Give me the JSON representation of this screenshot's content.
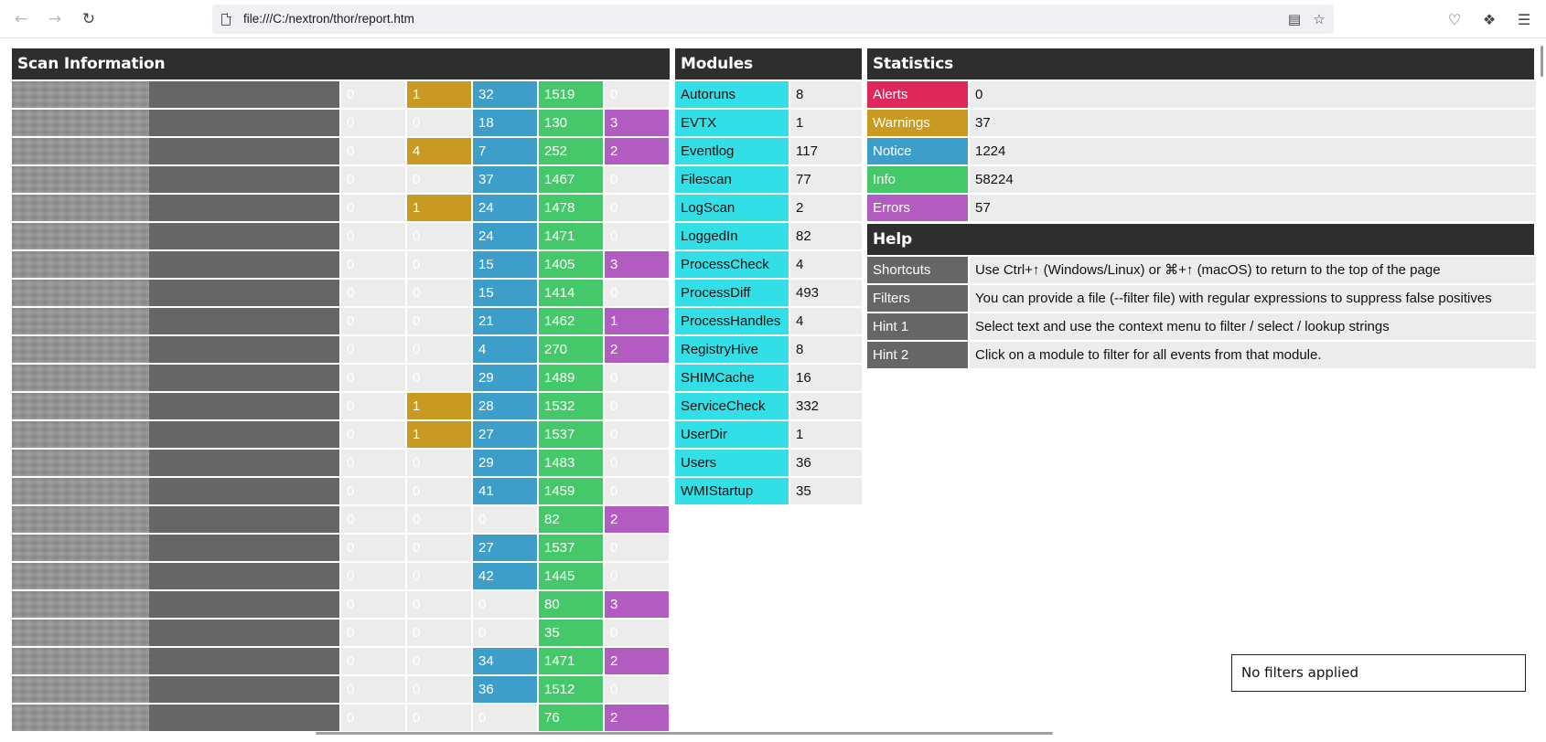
{
  "browser": {
    "url": "file:///C:/nextron/thor/report.htm",
    "icons": {
      "back": "arrow-left-icon",
      "forward": "arrow-right-icon",
      "reload": "reload-icon",
      "page": "page-icon",
      "reader": "reader-view-icon",
      "bookmark": "star-icon",
      "pocket": "pocket-icon",
      "extensions": "extensions-icon",
      "menu": "hamburger-menu-icon"
    }
  },
  "colors": {
    "header": "#2e2e2e",
    "alert": "#e0275a",
    "warning": "#c89a22",
    "notice": "#3d9fc9",
    "info": "#44c86a",
    "error": "#b25bc0",
    "module": "#33dfe6",
    "host": "#666666"
  },
  "scan": {
    "title": "Scan Information",
    "rows": [
      {
        "alerts": "0",
        "warnings": "1",
        "notices": "32",
        "infos": "1519",
        "errors": "0"
      },
      {
        "alerts": "0",
        "warnings": "0",
        "notices": "18",
        "infos": "130",
        "errors": "3"
      },
      {
        "alerts": "0",
        "warnings": "4",
        "notices": "7",
        "infos": "252",
        "errors": "2"
      },
      {
        "alerts": "0",
        "warnings": "0",
        "notices": "37",
        "infos": "1467",
        "errors": "0"
      },
      {
        "alerts": "0",
        "warnings": "1",
        "notices": "24",
        "infos": "1478",
        "errors": "0"
      },
      {
        "alerts": "0",
        "warnings": "0",
        "notices": "24",
        "infos": "1471",
        "errors": "0"
      },
      {
        "alerts": "0",
        "warnings": "0",
        "notices": "15",
        "infos": "1405",
        "errors": "3"
      },
      {
        "alerts": "0",
        "warnings": "0",
        "notices": "15",
        "infos": "1414",
        "errors": "0"
      },
      {
        "alerts": "0",
        "warnings": "0",
        "notices": "21",
        "infos": "1462",
        "errors": "1"
      },
      {
        "alerts": "0",
        "warnings": "0",
        "notices": "4",
        "infos": "270",
        "errors": "2"
      },
      {
        "alerts": "0",
        "warnings": "0",
        "notices": "29",
        "infos": "1489",
        "errors": "0"
      },
      {
        "alerts": "0",
        "warnings": "1",
        "notices": "28",
        "infos": "1532",
        "errors": "0"
      },
      {
        "alerts": "0",
        "warnings": "1",
        "notices": "27",
        "infos": "1537",
        "errors": "0"
      },
      {
        "alerts": "0",
        "warnings": "0",
        "notices": "29",
        "infos": "1483",
        "errors": "0"
      },
      {
        "alerts": "0",
        "warnings": "0",
        "notices": "41",
        "infos": "1459",
        "errors": "0"
      },
      {
        "alerts": "0",
        "warnings": "0",
        "notices": "0",
        "infos": "82",
        "errors": "2"
      },
      {
        "alerts": "0",
        "warnings": "0",
        "notices": "27",
        "infos": "1537",
        "errors": "0"
      },
      {
        "alerts": "0",
        "warnings": "0",
        "notices": "42",
        "infos": "1445",
        "errors": "0"
      },
      {
        "alerts": "0",
        "warnings": "0",
        "notices": "0",
        "infos": "80",
        "errors": "3"
      },
      {
        "alerts": "0",
        "warnings": "0",
        "notices": "0",
        "infos": "35",
        "errors": "0"
      },
      {
        "alerts": "0",
        "warnings": "0",
        "notices": "34",
        "infos": "1471",
        "errors": "2"
      },
      {
        "alerts": "0",
        "warnings": "0",
        "notices": "36",
        "infos": "1512",
        "errors": "0"
      },
      {
        "alerts": "0",
        "warnings": "0",
        "notices": "0",
        "infos": "76",
        "errors": "2"
      }
    ]
  },
  "modules": {
    "title": "Modules",
    "items": [
      {
        "name": "Autoruns",
        "count": "8"
      },
      {
        "name": "EVTX",
        "count": "1"
      },
      {
        "name": "Eventlog",
        "count": "117"
      },
      {
        "name": "Filescan",
        "count": "77"
      },
      {
        "name": "LogScan",
        "count": "2"
      },
      {
        "name": "LoggedIn",
        "count": "82"
      },
      {
        "name": "ProcessCheck",
        "count": "4"
      },
      {
        "name": "ProcessDiff",
        "count": "493"
      },
      {
        "name": "ProcessHandles",
        "count": "4"
      },
      {
        "name": "RegistryHive",
        "count": "8"
      },
      {
        "name": "SHIMCache",
        "count": "16"
      },
      {
        "name": "ServiceCheck",
        "count": "332"
      },
      {
        "name": "UserDir",
        "count": "1"
      },
      {
        "name": "Users",
        "count": "36"
      },
      {
        "name": "WMIStartup",
        "count": "35"
      }
    ]
  },
  "statistics": {
    "title": "Statistics",
    "items": [
      {
        "label": "Alerts",
        "value": "0",
        "color": "#e0275a"
      },
      {
        "label": "Warnings",
        "value": "37",
        "color": "#c89a22"
      },
      {
        "label": "Notice",
        "value": "1224",
        "color": "#3d9fc9"
      },
      {
        "label": "Info",
        "value": "58224",
        "color": "#44c86a"
      },
      {
        "label": "Errors",
        "value": "57",
        "color": "#b25bc0"
      }
    ]
  },
  "help": {
    "title": "Help",
    "items": [
      {
        "label": "Shortcuts",
        "text": "Use Ctrl+↑ (Windows/Linux) or ⌘+↑ (macOS) to return to the top of the page"
      },
      {
        "label": "Filters",
        "text": "You can provide a file (--filter file) with regular expressions to suppress false positives"
      },
      {
        "label": "Hint 1",
        "text": "Select text and use the context menu to filter / select / lookup strings"
      },
      {
        "label": "Hint 2",
        "text": "Click on a module to filter for all events from that module."
      }
    ]
  },
  "filter_status": "No filters applied"
}
